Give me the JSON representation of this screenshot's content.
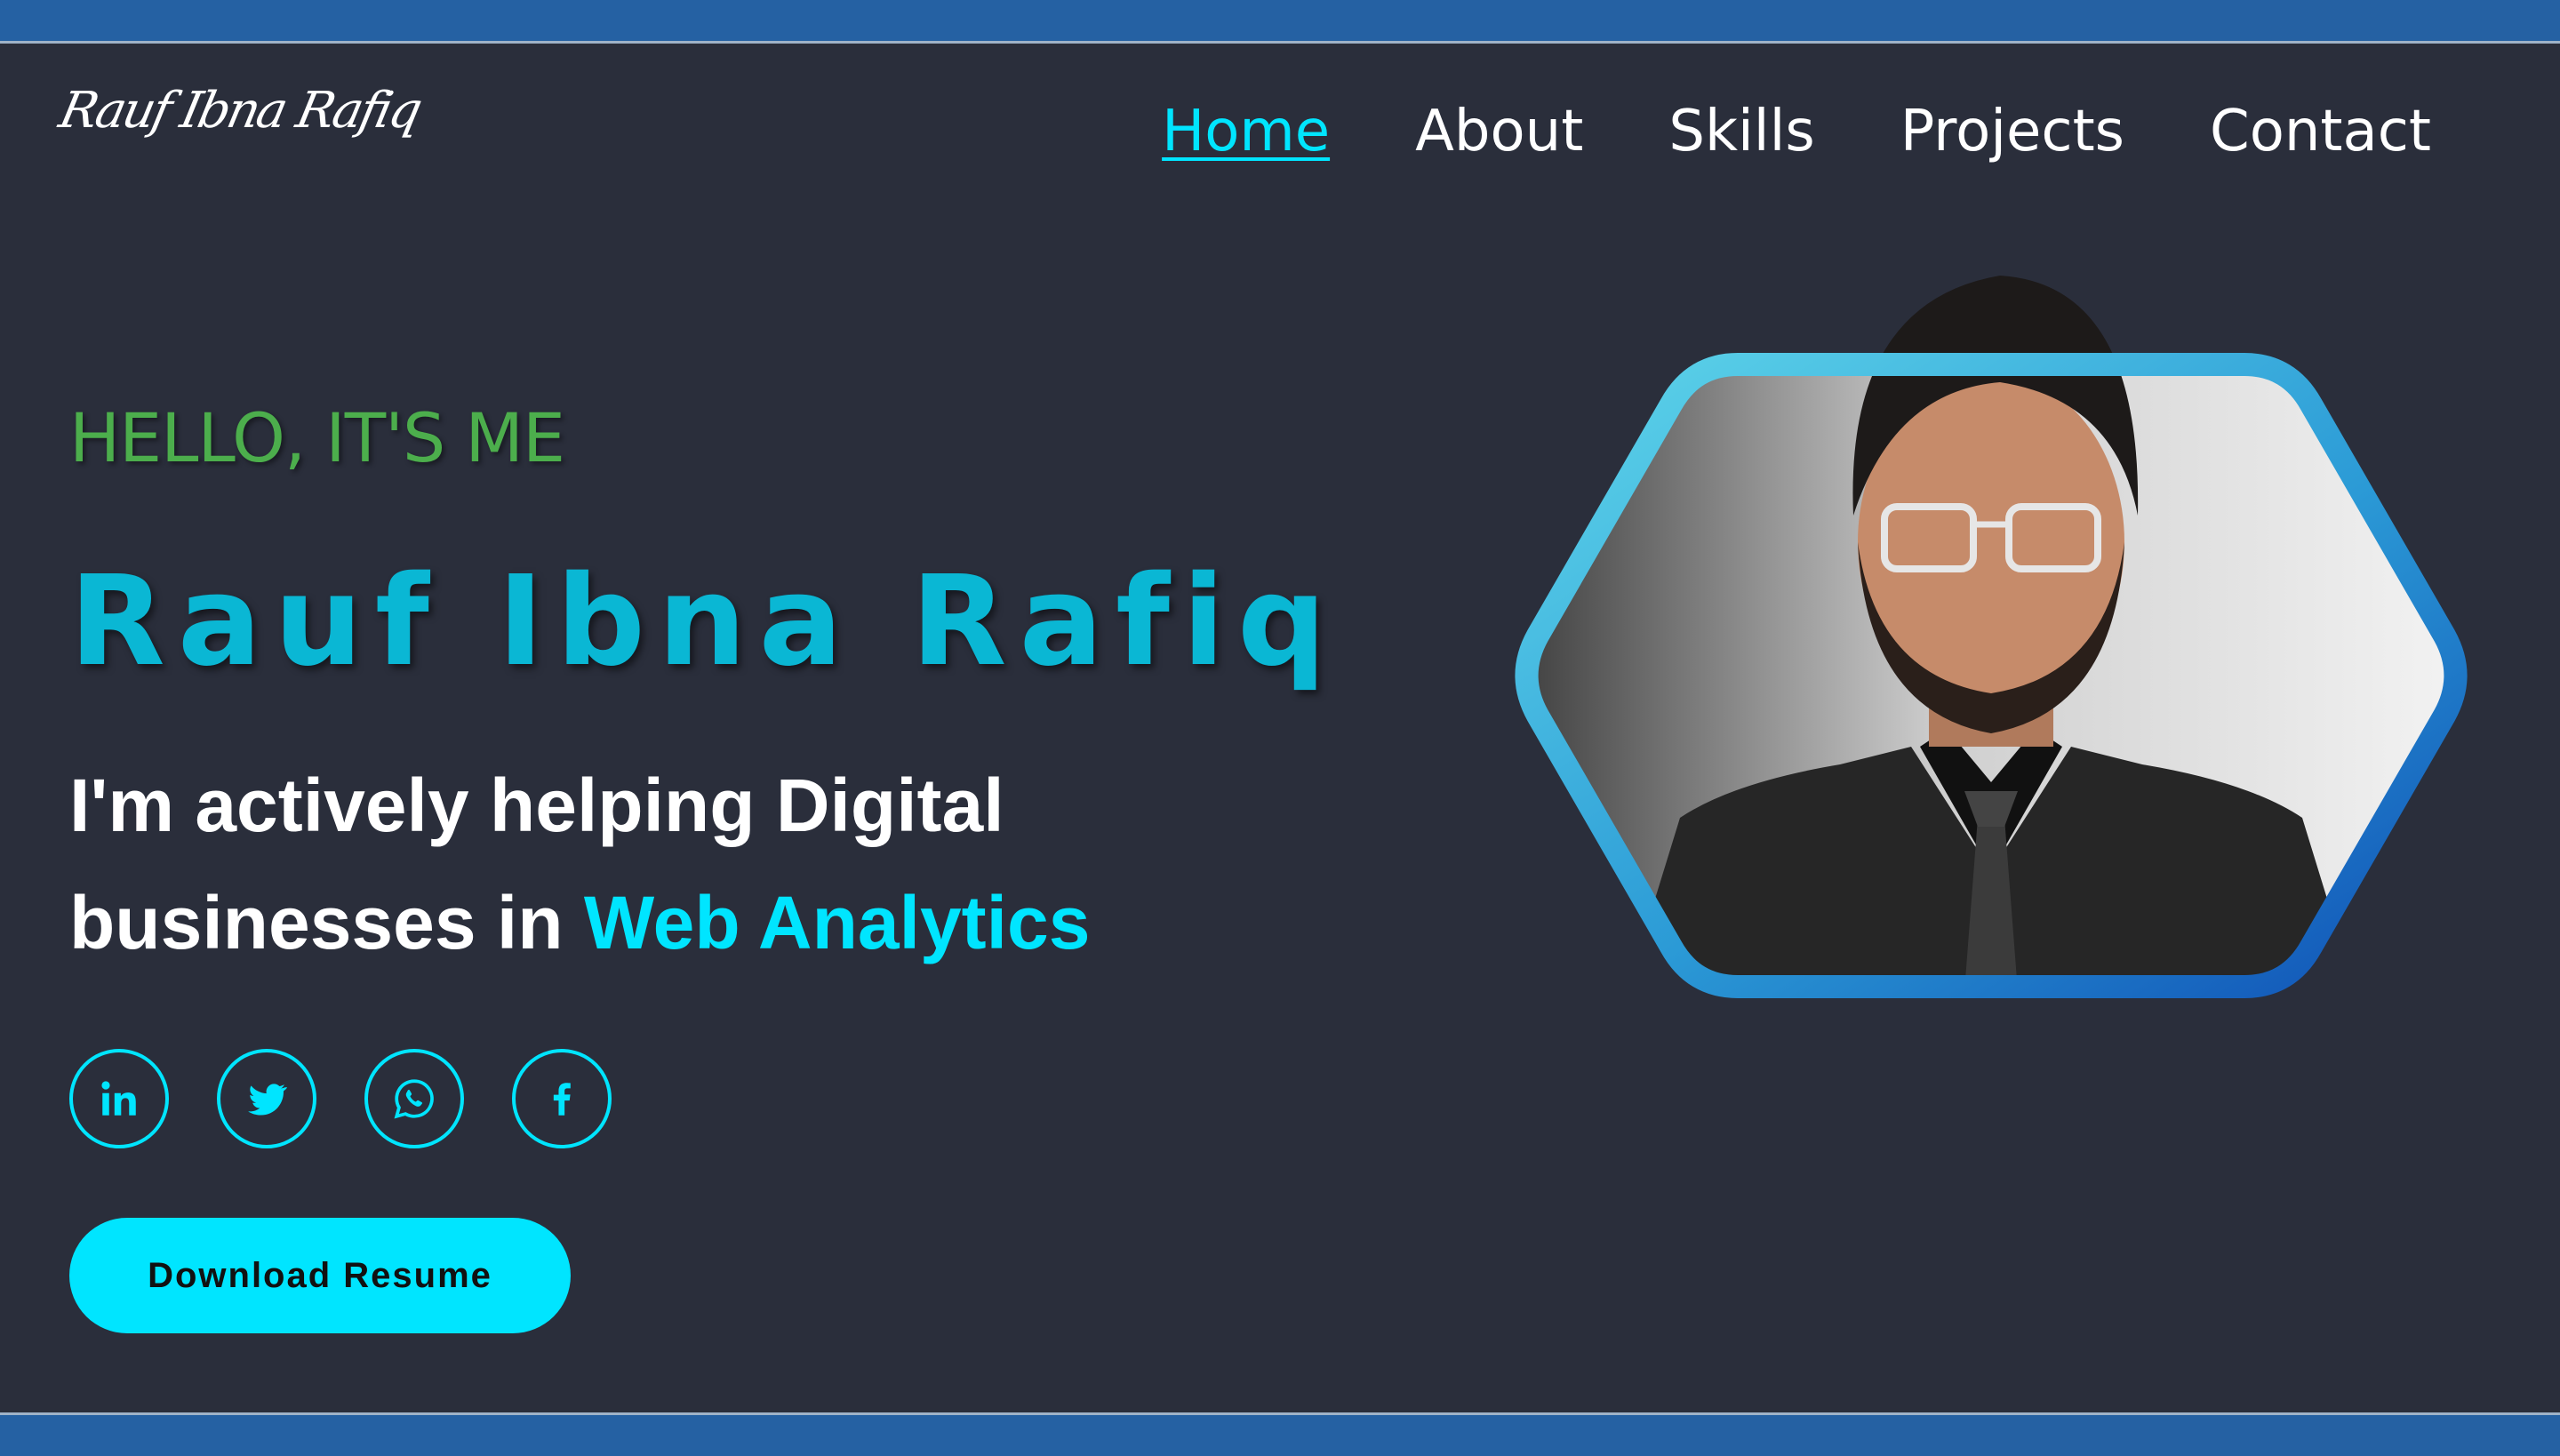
{
  "logo": {
    "text": "Rauf Ibna Rafiq"
  },
  "nav": {
    "items": [
      {
        "label": "Home",
        "active": true
      },
      {
        "label": "About"
      },
      {
        "label": "Skills"
      },
      {
        "label": "Projects"
      },
      {
        "label": "Contact"
      }
    ]
  },
  "hero": {
    "greeting": "HELLO, IT'S ME",
    "name": "Rauf Ibna Rafiq",
    "tagline_prefix": "I'm actively helping Digital businesses in ",
    "tagline_accent": "Web Analytics",
    "socials": [
      {
        "icon": "linkedin-icon"
      },
      {
        "icon": "twitter-icon"
      },
      {
        "icon": "whatsapp-icon"
      },
      {
        "icon": "facebook-icon"
      }
    ],
    "resume_button": "Download Resume"
  },
  "colors": {
    "background": "#2a2e3b",
    "frame": "#2561a3",
    "accent": "#00e5ff",
    "greeting": "#4cae4c",
    "name": "#0ab7d4"
  }
}
